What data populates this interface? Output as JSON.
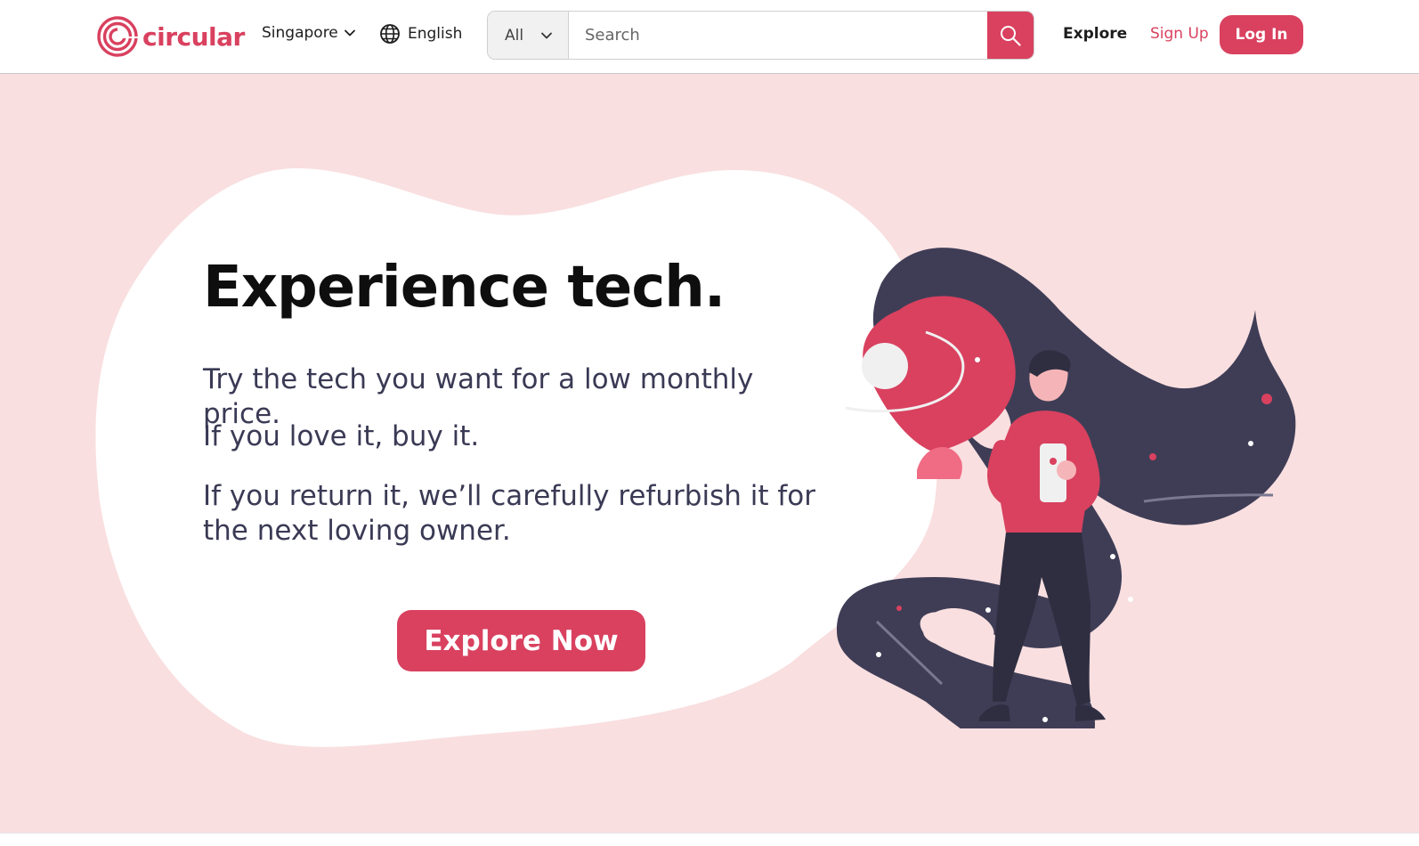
{
  "brand": {
    "name": "circular",
    "accent_color": "#d9415f",
    "hero_bg_color": "#f9dfe0"
  },
  "header": {
    "region_selector": {
      "value": "Singapore",
      "icon": "chevron-down-icon"
    },
    "language_selector": {
      "value": "English",
      "icon": "globe-icon"
    },
    "search": {
      "category": "All",
      "placeholder": "Search",
      "button_icon": "search-icon"
    },
    "nav": {
      "explore": "Explore",
      "sign_up": "Sign Up",
      "log_in": "Log In"
    }
  },
  "hero": {
    "title": "Experience tech.",
    "lines": [
      "Try the tech you want for a low monthly price.",
      "If you love it, buy it.",
      "If you return it, we’ll carefully refurbish it for the next loving owner."
    ],
    "cta": "Explore Now",
    "illustration": "person-holding-phone-with-space-swirl-illustration"
  }
}
